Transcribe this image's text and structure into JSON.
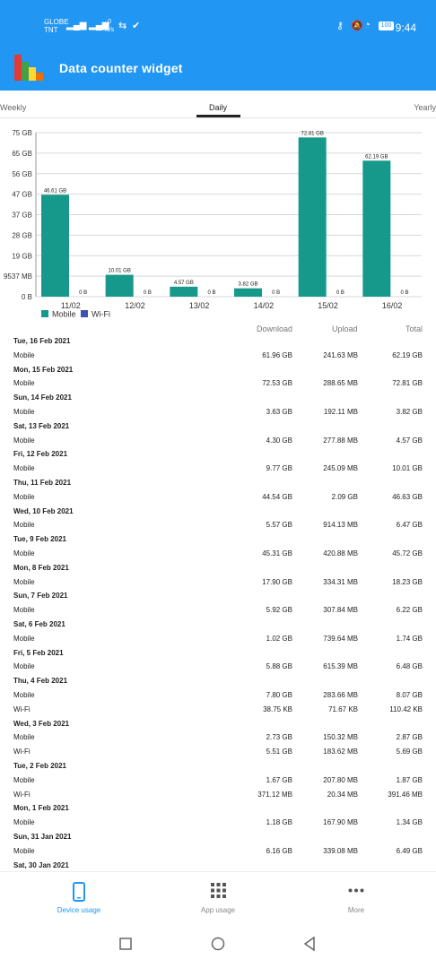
{
  "status": {
    "carrier1": "GLOBE",
    "carrier2": "TNT",
    "net_speed_top": "0",
    "net_speed_unit": "K/s",
    "battery": "100",
    "time": "9:44"
  },
  "app": {
    "title": "Data counter widget"
  },
  "tabs": [
    "Weekly",
    "Daily",
    "Yearly"
  ],
  "chart_data": {
    "type": "bar",
    "categories": [
      "11/02",
      "12/02",
      "13/02",
      "14/02",
      "15/02",
      "16/02"
    ],
    "series": [
      {
        "name": "Mobile",
        "values": [
          46.61,
          10.01,
          4.57,
          3.82,
          72.81,
          62.19
        ],
        "labels": [
          "46.61 GB",
          "10.01 GB",
          "4.57 GB",
          "3.82 GB",
          "72.81 GB",
          "62.19 GB"
        ]
      },
      {
        "name": "Wi-Fi",
        "values": [
          0,
          0,
          0,
          0,
          0,
          0
        ],
        "labels": [
          "0 B",
          "0 B",
          "0 B",
          "0 B",
          "0 B",
          "0 B"
        ]
      }
    ],
    "ytick_labels": [
      "75 GB",
      "65 GB",
      "56 GB",
      "47 GB",
      "37 GB",
      "28 GB",
      "19 GB",
      "9537 MB",
      "0 B"
    ],
    "ylim": [
      0,
      75
    ],
    "grid": true,
    "legend": "bottom-left",
    "colors": {
      "mobile": "#16998a",
      "wifi": "#3f51b5"
    }
  },
  "columns": {
    "download": "Download",
    "upload": "Upload",
    "total": "Total"
  },
  "rows": [
    {
      "type": "date",
      "text": "Tue, 16 Feb 2021"
    },
    {
      "type": "data",
      "label": "Mobile",
      "download": "61.96 GB",
      "upload": "241.63 MB",
      "total": "62.19 GB"
    },
    {
      "type": "date",
      "text": "Mon, 15 Feb 2021"
    },
    {
      "type": "data",
      "label": "Mobile",
      "download": "72.53 GB",
      "upload": "288.65 MB",
      "total": "72.81 GB"
    },
    {
      "type": "date",
      "text": "Sun, 14 Feb 2021"
    },
    {
      "type": "data",
      "label": "Mobile",
      "download": "3.63 GB",
      "upload": "192.11 MB",
      "total": "3.82 GB"
    },
    {
      "type": "date",
      "text": "Sat, 13 Feb 2021"
    },
    {
      "type": "data",
      "label": "Mobile",
      "download": "4.30 GB",
      "upload": "277.88 MB",
      "total": "4.57 GB"
    },
    {
      "type": "date",
      "text": "Fri, 12 Feb 2021"
    },
    {
      "type": "data",
      "label": "Mobile",
      "download": "9.77 GB",
      "upload": "245.09 MB",
      "total": "10.01 GB"
    },
    {
      "type": "date",
      "text": "Thu, 11 Feb 2021"
    },
    {
      "type": "data",
      "label": "Mobile",
      "download": "44.54 GB",
      "upload": "2.09 GB",
      "total": "46.63 GB"
    },
    {
      "type": "date",
      "text": "Wed, 10 Feb 2021"
    },
    {
      "type": "data",
      "label": "Mobile",
      "download": "5.57 GB",
      "upload": "914.13 MB",
      "total": "6.47 GB"
    },
    {
      "type": "date",
      "text": "Tue, 9 Feb 2021"
    },
    {
      "type": "data",
      "label": "Mobile",
      "download": "45.31 GB",
      "upload": "420.88 MB",
      "total": "45.72 GB"
    },
    {
      "type": "date",
      "text": "Mon, 8 Feb 2021"
    },
    {
      "type": "data",
      "label": "Mobile",
      "download": "17.90 GB",
      "upload": "334.31 MB",
      "total": "18.23 GB"
    },
    {
      "type": "date",
      "text": "Sun, 7 Feb 2021"
    },
    {
      "type": "data",
      "label": "Mobile",
      "download": "5.92 GB",
      "upload": "307.84 MB",
      "total": "6.22 GB"
    },
    {
      "type": "date",
      "text": "Sat, 6 Feb 2021"
    },
    {
      "type": "data",
      "label": "Mobile",
      "download": "1.02 GB",
      "upload": "739.64 MB",
      "total": "1.74 GB"
    },
    {
      "type": "date",
      "text": "Fri, 5 Feb 2021"
    },
    {
      "type": "data",
      "label": "Mobile",
      "download": "5.88 GB",
      "upload": "615.39 MB",
      "total": "6.48 GB"
    },
    {
      "type": "date",
      "text": "Thu, 4 Feb 2021"
    },
    {
      "type": "data",
      "label": "Mobile",
      "download": "7.80 GB",
      "upload": "283.66 MB",
      "total": "8.07 GB"
    },
    {
      "type": "data",
      "label": "Wi-Fi",
      "download": "38.75 KB",
      "upload": "71.67 KB",
      "total": "110.42 KB"
    },
    {
      "type": "date",
      "text": "Wed, 3 Feb 2021"
    },
    {
      "type": "data",
      "label": "Mobile",
      "download": "2.73 GB",
      "upload": "150.32 MB",
      "total": "2.87 GB"
    },
    {
      "type": "data",
      "label": "Wi-Fi",
      "download": "5.51 GB",
      "upload": "183.62 MB",
      "total": "5.69 GB"
    },
    {
      "type": "date",
      "text": "Tue, 2 Feb 2021"
    },
    {
      "type": "data",
      "label": "Mobile",
      "download": "1.67 GB",
      "upload": "207.80 MB",
      "total": "1.87 GB"
    },
    {
      "type": "data",
      "label": "Wi-Fi",
      "download": "371.12 MB",
      "upload": "20.34 MB",
      "total": "391.46 MB"
    },
    {
      "type": "date",
      "text": "Mon, 1 Feb 2021"
    },
    {
      "type": "data",
      "label": "Mobile",
      "download": "1.18 GB",
      "upload": "167.90 MB",
      "total": "1.34 GB"
    },
    {
      "type": "date",
      "text": "Sun, 31 Jan 2021"
    },
    {
      "type": "data",
      "label": "Mobile",
      "download": "6.16 GB",
      "upload": "339.08 MB",
      "total": "6.49 GB"
    },
    {
      "type": "date",
      "text": "Sat, 30 Jan 2021"
    }
  ],
  "bottom_nav": [
    {
      "label": "Device usage",
      "icon": "phone-icon",
      "active": true
    },
    {
      "label": "App usage",
      "icon": "grid-icon",
      "active": false
    },
    {
      "label": "More",
      "icon": "more-dots-icon",
      "active": false
    }
  ]
}
